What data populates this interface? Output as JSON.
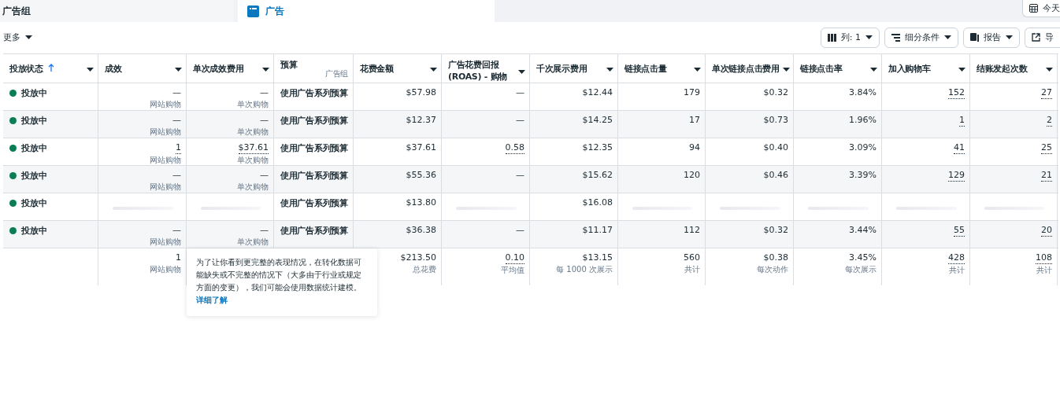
{
  "tabs": [
    {
      "label": "广告组",
      "selected": false,
      "icon": false
    },
    {
      "label": "广告",
      "selected": true,
      "icon": true
    }
  ],
  "date_button": {
    "label": "今天"
  },
  "toolbar": {
    "more": "更多",
    "buttons": [
      {
        "label": "列: 1"
      },
      {
        "label": "细分条件"
      },
      {
        "label": "报告"
      },
      {
        "label": "导"
      }
    ]
  },
  "table": {
    "columns": [
      {
        "label": "投放状态",
        "sorted": true,
        "menu": true
      },
      {
        "label": "成效",
        "sorted": false,
        "menu": true
      },
      {
        "label": "单次成效费用",
        "sorted": false,
        "menu": true
      },
      {
        "label": "预算",
        "sorted": false,
        "menu": false,
        "sub": "广告组"
      },
      {
        "label": "花费金额",
        "sorted": false,
        "menu": true
      },
      {
        "label": "广告花费回报 (ROAS) - 购物",
        "sorted": false,
        "menu": true
      },
      {
        "label": "千次展示费用",
        "sorted": false,
        "menu": true
      },
      {
        "label": "链接点击量",
        "sorted": false,
        "menu": true
      },
      {
        "label": "单次链接点击费用",
        "sorted": false,
        "menu": true
      },
      {
        "label": "链接点击率",
        "sorted": false,
        "menu": true
      },
      {
        "label": "加入购物车",
        "sorted": false,
        "menu": true
      },
      {
        "label": "结账发起次数",
        "sorted": false,
        "menu": true
      }
    ],
    "rows": [
      {
        "cells": [
          {
            "kind": "status",
            "label": "投放中",
            "color": "#0a7d54"
          },
          {
            "kind": "value",
            "value": "—",
            "sub": "网站购物",
            "dotted": false
          },
          {
            "kind": "value",
            "value": "—",
            "sub": "单次购物",
            "dotted": false
          },
          {
            "kind": "budget",
            "value": "使用广告系列预算"
          },
          {
            "kind": "value",
            "value": "$57.98",
            "dotted": false
          },
          {
            "kind": "value",
            "value": "—",
            "dotted": false
          },
          {
            "kind": "value",
            "value": "$12.44",
            "dotted": false
          },
          {
            "kind": "value",
            "value": "179",
            "dotted": false
          },
          {
            "kind": "value",
            "value": "$0.32",
            "dotted": false
          },
          {
            "kind": "value",
            "value": "3.84%",
            "dotted": false
          },
          {
            "kind": "value",
            "value": "152",
            "dotted": true
          },
          {
            "kind": "value",
            "value": "27",
            "dotted": true
          }
        ]
      },
      {
        "cells": [
          {
            "kind": "status",
            "label": "投放中",
            "color": "#0a7d54"
          },
          {
            "kind": "value",
            "value": "—",
            "sub": "网站购物",
            "dotted": false
          },
          {
            "kind": "value",
            "value": "—",
            "sub": "单次购物",
            "dotted": false
          },
          {
            "kind": "budget",
            "value": "使用广告系列预算"
          },
          {
            "kind": "value",
            "value": "$12.37",
            "dotted": false
          },
          {
            "kind": "value",
            "value": "—",
            "dotted": false
          },
          {
            "kind": "value",
            "value": "$14.25",
            "dotted": false
          },
          {
            "kind": "value",
            "value": "17",
            "dotted": false
          },
          {
            "kind": "value",
            "value": "$0.73",
            "dotted": false
          },
          {
            "kind": "value",
            "value": "1.96%",
            "dotted": false
          },
          {
            "kind": "value",
            "value": "1",
            "dotted": true
          },
          {
            "kind": "value",
            "value": "2",
            "dotted": true
          }
        ]
      },
      {
        "cells": [
          {
            "kind": "status",
            "label": "投放中",
            "color": "#0a7d54"
          },
          {
            "kind": "value",
            "value": "1",
            "sub": "网站购物",
            "dotted": true
          },
          {
            "kind": "value",
            "value": "$37.61",
            "sub": "单次购物",
            "dotted": true
          },
          {
            "kind": "budget",
            "value": "使用广告系列预算"
          },
          {
            "kind": "value",
            "value": "$37.61",
            "dotted": false
          },
          {
            "kind": "value",
            "value": "0.58",
            "dotted": true
          },
          {
            "kind": "value",
            "value": "$12.35",
            "dotted": false
          },
          {
            "kind": "value",
            "value": "94",
            "dotted": false
          },
          {
            "kind": "value",
            "value": "$0.40",
            "dotted": false
          },
          {
            "kind": "value",
            "value": "3.09%",
            "dotted": false
          },
          {
            "kind": "value",
            "value": "41",
            "dotted": true
          },
          {
            "kind": "value",
            "value": "25",
            "dotted": true
          }
        ]
      },
      {
        "cells": [
          {
            "kind": "status",
            "label": "投放中",
            "color": "#0a7d54"
          },
          {
            "kind": "value",
            "value": "—",
            "sub": "网站购物",
            "dotted": false
          },
          {
            "kind": "value",
            "value": "—",
            "sub": "单次购物",
            "dotted": false
          },
          {
            "kind": "budget",
            "value": "使用广告系列预算"
          },
          {
            "kind": "value",
            "value": "$55.36",
            "dotted": false
          },
          {
            "kind": "value",
            "value": "—",
            "dotted": false
          },
          {
            "kind": "value",
            "value": "$15.62",
            "dotted": false
          },
          {
            "kind": "value",
            "value": "120",
            "dotted": false
          },
          {
            "kind": "value",
            "value": "$0.46",
            "dotted": false
          },
          {
            "kind": "value",
            "value": "3.39%",
            "dotted": false
          },
          {
            "kind": "value",
            "value": "129",
            "dotted": true
          },
          {
            "kind": "value",
            "value": "21",
            "dotted": true
          }
        ]
      },
      {
        "cells": [
          {
            "kind": "status",
            "label": "投放中",
            "color": "#0a7d54"
          },
          {
            "kind": "loading"
          },
          {
            "kind": "loading"
          },
          {
            "kind": "budget",
            "value": "使用广告系列预算"
          },
          {
            "kind": "value",
            "value": "$13.80",
            "dotted": false
          },
          {
            "kind": "loading"
          },
          {
            "kind": "value",
            "value": "$16.08",
            "dotted": false
          },
          {
            "kind": "loading"
          },
          {
            "kind": "loading"
          },
          {
            "kind": "loading"
          },
          {
            "kind": "loading"
          },
          {
            "kind": "loading"
          }
        ]
      },
      {
        "cells": [
          {
            "kind": "status",
            "label": "投放中",
            "color": "#0a7d54"
          },
          {
            "kind": "value",
            "value": "—",
            "sub": "网站购物",
            "dotted": false
          },
          {
            "kind": "value",
            "value": "—",
            "sub": "单次购物",
            "dotted": false
          },
          {
            "kind": "budget",
            "value": "使用广告系列预算"
          },
          {
            "kind": "value",
            "value": "$36.38",
            "dotted": false
          },
          {
            "kind": "value",
            "value": "—",
            "dotted": false
          },
          {
            "kind": "value",
            "value": "$11.17",
            "dotted": false
          },
          {
            "kind": "value",
            "value": "112",
            "dotted": false
          },
          {
            "kind": "value",
            "value": "$0.32",
            "dotted": false
          },
          {
            "kind": "value",
            "value": "3.44%",
            "dotted": false
          },
          {
            "kind": "value",
            "value": "55",
            "dotted": true
          },
          {
            "kind": "value",
            "value": "20",
            "dotted": true
          }
        ]
      }
    ],
    "summary": [
      {
        "kind": "empty"
      },
      {
        "kind": "value",
        "value": "1",
        "sub": "网站购物",
        "dotted": false
      },
      {
        "kind": "empty"
      },
      {
        "kind": "empty"
      },
      {
        "kind": "value",
        "value": "$213.50",
        "sub": "总花费",
        "dotted": false
      },
      {
        "kind": "value",
        "value": "0.10",
        "sub": "平均值",
        "dotted": true
      },
      {
        "kind": "value",
        "value": "$13.15",
        "sub": "每 1000 次展示",
        "dotted": false
      },
      {
        "kind": "value",
        "value": "560",
        "sub": "共计",
        "dotted": false
      },
      {
        "kind": "value",
        "value": "$0.38",
        "sub": "每次动作",
        "dotted": false
      },
      {
        "kind": "value",
        "value": "3.45%",
        "sub": "每次展示",
        "dotted": false
      },
      {
        "kind": "value",
        "value": "428",
        "sub": "共计",
        "dotted": true
      },
      {
        "kind": "value",
        "value": "108",
        "sub": "共计",
        "dotted": true
      }
    ]
  },
  "tooltip": {
    "text": "为了让你看到更完整的表现情况，在转化数据可能缺失或不完整的情况下（大多由于行业或规定方面的变更），我们可能会使用数据统计建模。",
    "link": "详细了解"
  }
}
